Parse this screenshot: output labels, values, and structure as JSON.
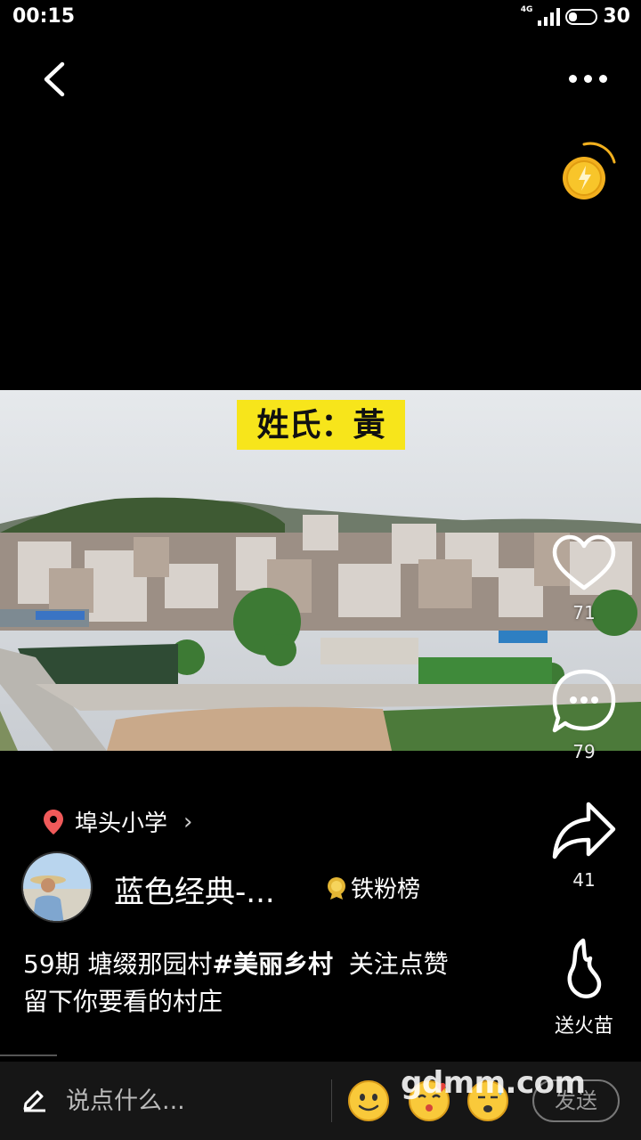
{
  "status_bar": {
    "time": "00:15",
    "network": "4G",
    "battery": "30"
  },
  "video": {
    "surname_caption": "姓氏：黃"
  },
  "actions": {
    "like_count": "71",
    "comment_count": "79",
    "share_count": "41",
    "gift_label": "送火苗"
  },
  "location": {
    "name": "埠头小学"
  },
  "author": {
    "name": "蓝色经典-...",
    "rank_label": "铁粉榜"
  },
  "caption": {
    "prefix": "59期 塘缀那园村",
    "hashtag": "#美丽乡村",
    "suffix": "  关注点赞",
    "line2": "留下你要看的村庄"
  },
  "bottom_bar": {
    "placeholder": "说点什么...",
    "send_label": "发送"
  },
  "watermark": "gdmm.com",
  "colors": {
    "accent_yellow": "#f7e51b",
    "pin_red": "#f05a5a",
    "coin_gold": "#f2b01e"
  }
}
